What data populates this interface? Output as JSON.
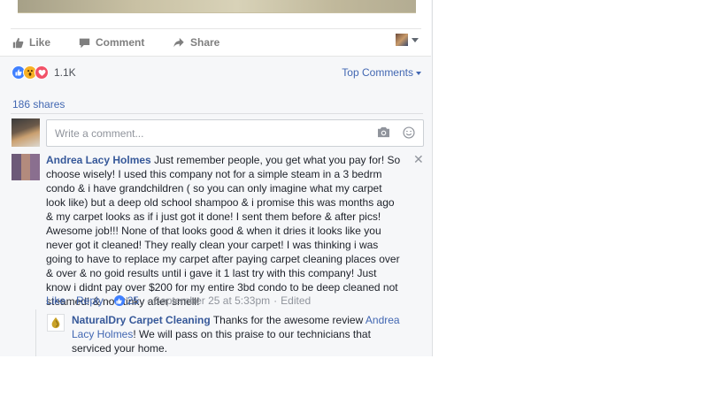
{
  "actions": {
    "like": "Like",
    "comment": "Comment",
    "share": "Share"
  },
  "reactions": {
    "count": "1.1K",
    "types": [
      "like-icon",
      "wow-icon",
      "love-icon"
    ]
  },
  "top_comments": "Top Comments",
  "shares": "186 shares",
  "composer": {
    "placeholder": "Write a comment..."
  },
  "comment": {
    "author": "Andrea Lacy Holmes",
    "text": "Just remember people, you get what you pay for! So choose wisely! I used this company not for a simple steam in a 3 bedrm condo & i have grandchildren ( so you can only imagine what my carpet look like) but a deep old school shampoo & i promise this was months ago & my carpet looks as if i just got it done! I sent them before & after pics! Awesome job!!! None of that looks good & when it dries it looks like you never got it cleaned! They really clean your carpet! I was thinking i was going to have to replace my carpet after paying carpet cleaning places over & over & no goid results until i gave it 1 last try with this company! Just know i didnt pay over $200 for my entire 3bd condo to be deep cleaned not steamed! & no stinky after smell!",
    "like_label": "Like",
    "reply_label": "Reply",
    "likes": "25",
    "timestamp": "September 25 at 5:33pm",
    "edited": "Edited",
    "sep": "·"
  },
  "reply": {
    "author": "NaturalDry Carpet Cleaning",
    "text_before": "Thanks for the awesome review",
    "mention": "Andrea Lacy Holmes",
    "text_after": "! We will pass on this praise to our technicians that serviced your home."
  },
  "colors": {
    "link": "#4267b2",
    "name": "#365899",
    "like_blue": "#4080ff",
    "wow": "#f7b125",
    "love": "#f25268"
  }
}
